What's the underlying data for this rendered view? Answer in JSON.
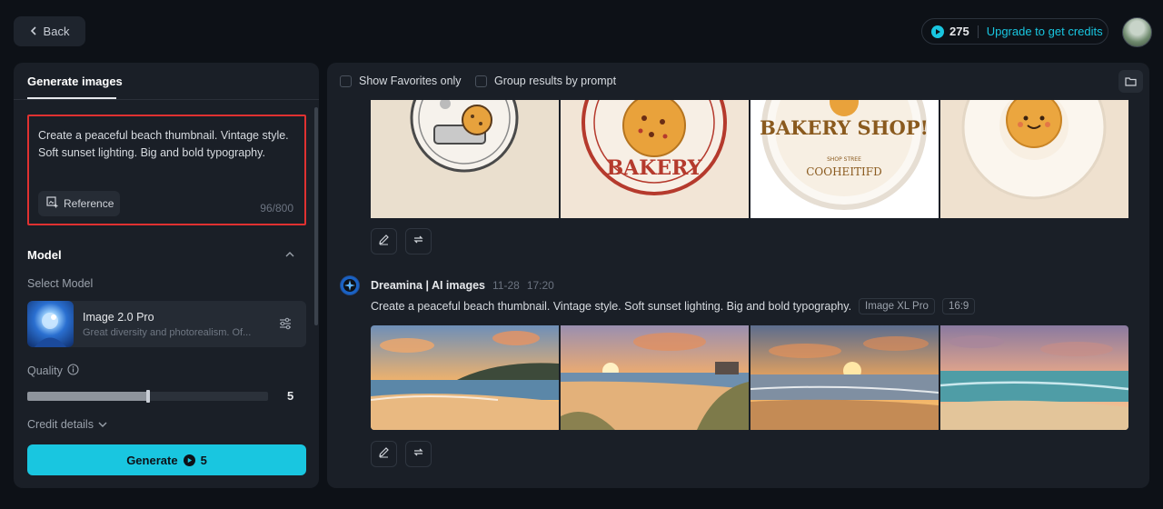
{
  "header": {
    "back_label": "Back",
    "credits_count": "275",
    "upgrade_label": "Upgrade to get credits"
  },
  "left_panel": {
    "tab_label": "Generate images",
    "prompt_text": "Create a peaceful beach thumbnail. Vintage style. Soft sunset lighting. Big and bold typography.",
    "reference_label": "Reference",
    "char_count": "96/800",
    "model_section_title": "Model",
    "select_model_label": "Select Model",
    "model_name": "Image 2.0 Pro",
    "model_description": "Great diversity and photorealism. Of...",
    "quality_label": "Quality",
    "quality_value": "5",
    "quality_fraction": 0.5,
    "credit_details_label": "Credit details",
    "generate_label": "Generate",
    "generate_cost": "5"
  },
  "right_panel": {
    "show_favorites_label": "Show Favorites only",
    "group_results_label": "Group results by prompt",
    "previous_result": {
      "image_texts": [
        "BAKERY",
        "BAKERY SHOP!",
        "SHOP STREE",
        "COOHEITIFD"
      ]
    },
    "generation": {
      "author": "Dreamina | AI images",
      "date": "11-28",
      "time": "17:20",
      "prompt": "Create a peaceful beach thumbnail. Vintage style. Soft sunset lighting. Big and bold typography.",
      "model_tag": "Image XL Pro",
      "ratio_tag": "16:9"
    }
  },
  "colors": {
    "accent": "#19c6e0",
    "highlight_border": "#e03131",
    "panel_bg": "#1a1f27",
    "page_bg": "#0d1117"
  },
  "icons": [
    "chevron-left-icon",
    "coin-icon",
    "add-image-icon",
    "chevron-up-icon",
    "settings-sliders-icon",
    "info-icon",
    "chevron-down-icon",
    "folder-icon",
    "edit-icon",
    "regenerate-icon",
    "dreamina-logo-icon"
  ]
}
